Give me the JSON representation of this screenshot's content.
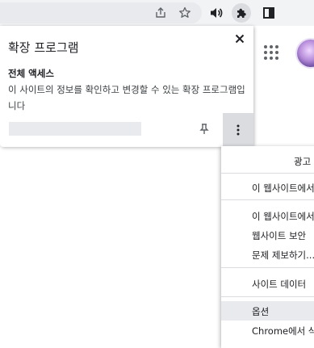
{
  "toolbar": {
    "icons": [
      "share-icon",
      "bookmark-star-icon",
      "media-control-icon",
      "extensions-puzzle-icon",
      "side-panel-icon"
    ]
  },
  "popup": {
    "title": "확장 프로그램",
    "section_title": "전체 액세스",
    "section_desc": "이 사이트의 정보를 확인하고 변경할 수 있는 확장 프로그램입니다"
  },
  "menu": {
    "items": [
      {
        "label": "광고",
        "highlight": false
      },
      {
        "label": "이 웹사이트에서",
        "highlight": false
      },
      {
        "label": "이 웹사이트에서",
        "highlight": false
      },
      {
        "label": "웹사이트 보안",
        "highlight": false
      },
      {
        "label": "문제 제보하기...",
        "highlight": false
      },
      {
        "label": "사이트 데이터",
        "highlight": false
      },
      {
        "label": "옵션",
        "highlight": true
      },
      {
        "label": "Chrome에서 삭",
        "highlight": false
      }
    ]
  },
  "colors": {
    "toolbar_bg": "#f1f3f4",
    "menu_highlight": "#e8eaed",
    "more_button_active": "#dadce0"
  }
}
